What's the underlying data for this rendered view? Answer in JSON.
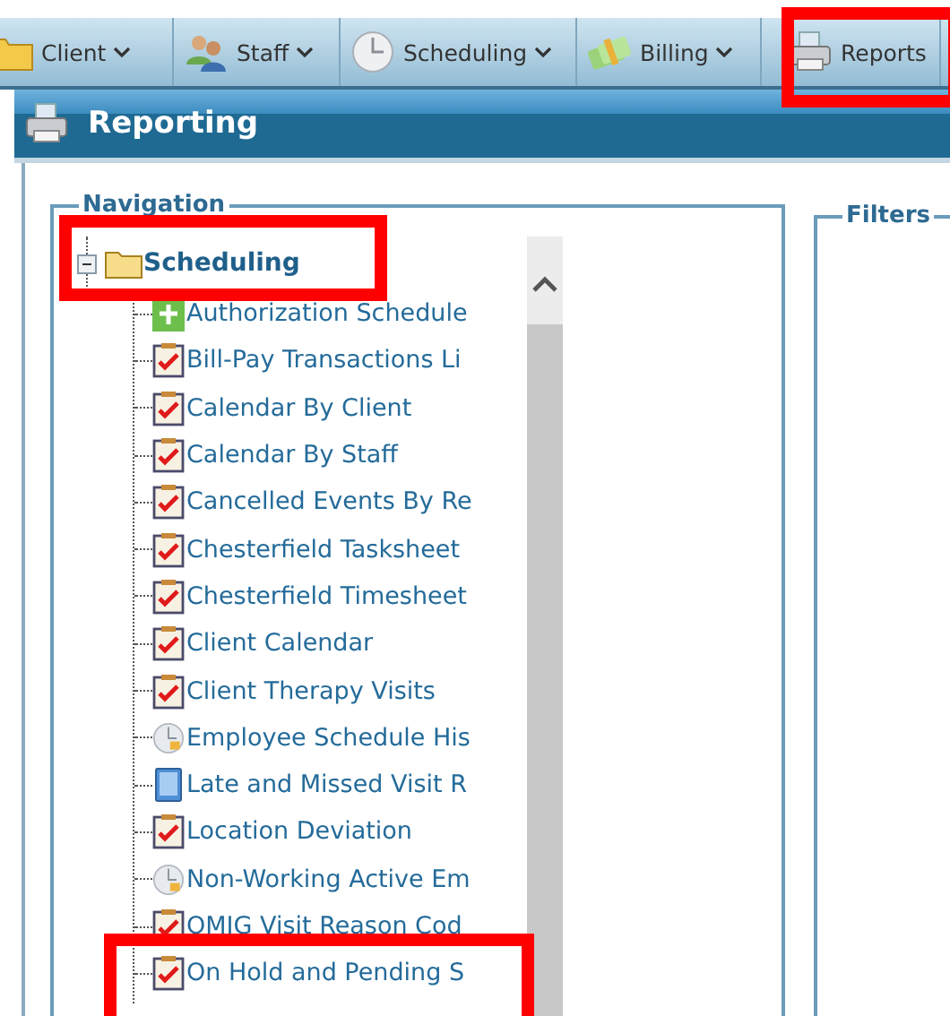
{
  "toolbar": [
    {
      "label": "Client",
      "kind": "folder",
      "dropdown": true
    },
    {
      "label": "Staff",
      "kind": "people",
      "dropdown": true
    },
    {
      "label": "Scheduling",
      "kind": "clock",
      "dropdown": true
    },
    {
      "label": "Billing",
      "kind": "money",
      "dropdown": true
    },
    {
      "label": "Reports",
      "kind": "printer",
      "dropdown": false
    }
  ],
  "header": {
    "title": "Reporting"
  },
  "navigation": {
    "legend": "Navigation",
    "tree": {
      "label": "Scheduling",
      "expanded": true,
      "children": [
        {
          "label": "Authorization Schedule",
          "kind": "plus"
        },
        {
          "label": "Bill-Pay Transactions Li",
          "kind": "checklist"
        },
        {
          "label": "Calendar By Client",
          "kind": "checklist"
        },
        {
          "label": "Calendar By Staff",
          "kind": "checklist"
        },
        {
          "label": "Cancelled Events By Re",
          "kind": "checklist"
        },
        {
          "label": "Chesterfield Tasksheet",
          "kind": "checklist"
        },
        {
          "label": "Chesterfield Timesheet",
          "kind": "checklist"
        },
        {
          "label": "Client Calendar",
          "kind": "checklist"
        },
        {
          "label": "Client Therapy Visits",
          "kind": "checklist"
        },
        {
          "label": "Employee Schedule His",
          "kind": "clock"
        },
        {
          "label": "Late and Missed Visit R",
          "kind": "tablet"
        },
        {
          "label": "Location Deviation",
          "kind": "checklist"
        },
        {
          "label": "Non-Working Active Em",
          "kind": "clock"
        },
        {
          "label": "OMIG Visit Reason Cod",
          "kind": "checklist"
        },
        {
          "label": "On Hold and Pending S",
          "kind": "checklist"
        }
      ]
    }
  },
  "filters": {
    "legend": "Filters"
  }
}
